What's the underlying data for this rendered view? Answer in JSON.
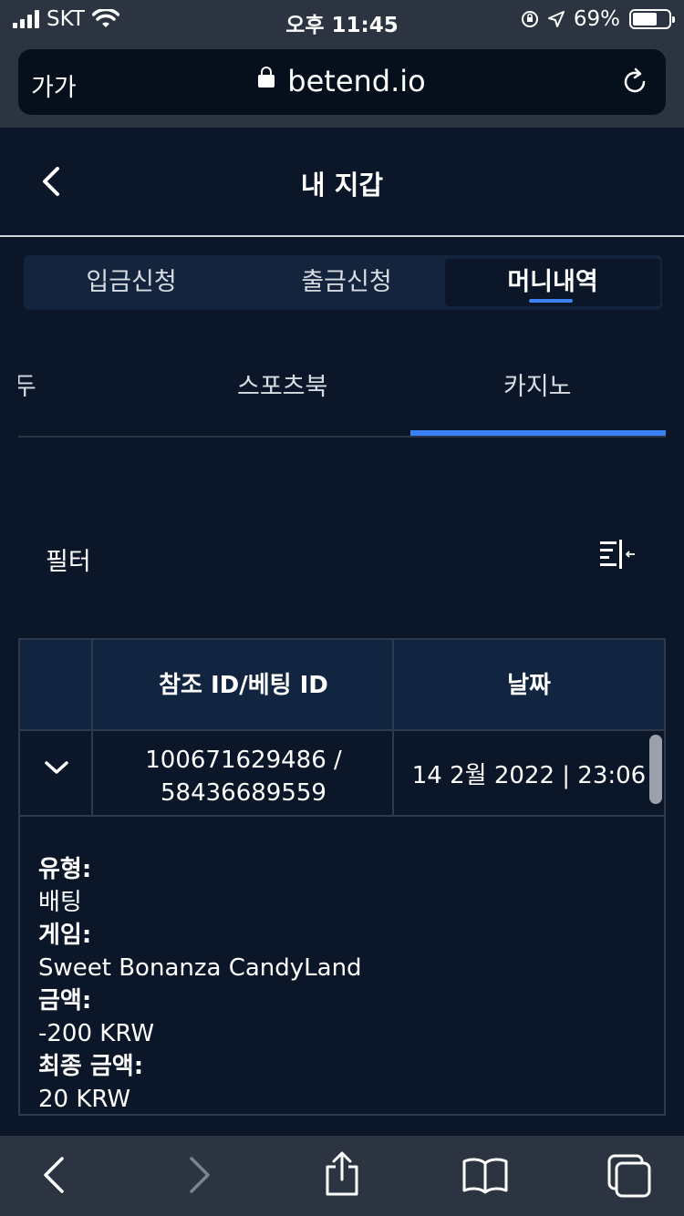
{
  "status_bar": {
    "carrier": "SKT",
    "time": "오후 11:45",
    "battery": "69%",
    "battery_level": 0.69,
    "icons": [
      "signal-icon",
      "wifi-icon",
      "orientation-lock-icon",
      "location-icon",
      "battery-icon"
    ]
  },
  "browser": {
    "text_size_label": "가가",
    "url": "betend.io",
    "icons": [
      "lock-icon",
      "reload-icon"
    ]
  },
  "header": {
    "title": "내 지갑",
    "back_icon": "chevron-left-icon"
  },
  "segment_tabs": [
    {
      "label": "입금신청",
      "active": false
    },
    {
      "label": "출금신청",
      "active": false
    },
    {
      "label": "머니내역",
      "active": true
    }
  ],
  "sub_tabs": [
    {
      "label": "모두",
      "active": false
    },
    {
      "label": "스포츠북",
      "active": false
    },
    {
      "label": "카지노",
      "active": true
    }
  ],
  "filter": {
    "label": "필터",
    "icon": "filter-collapse-icon"
  },
  "table": {
    "headers": [
      "",
      "참조 ID/베팅 ID",
      "날짜"
    ],
    "rows": [
      {
        "ref_id": "100671629486 /",
        "bet_id": "58436689559",
        "date": "14 2월 2022 | 23:06",
        "expand_icon": "chevron-down-icon"
      }
    ],
    "detail": {
      "type_label": "유형:",
      "type_value": "배팅",
      "game_label": "게임:",
      "game_value": "Sweet Bonanza CandyLand",
      "amount_label": "금액:",
      "amount_value": "-200 KRW",
      "final_label": "최종 금액:",
      "final_value": "20 KRW"
    }
  },
  "toolbar": {
    "icons": [
      "back-arrow-icon",
      "forward-arrow-icon",
      "share-icon",
      "bookmarks-icon",
      "tabs-icon"
    ]
  },
  "colors": {
    "background": "#0b1628",
    "accent": "#3b82f6",
    "browser_chrome": "#2b3440"
  }
}
